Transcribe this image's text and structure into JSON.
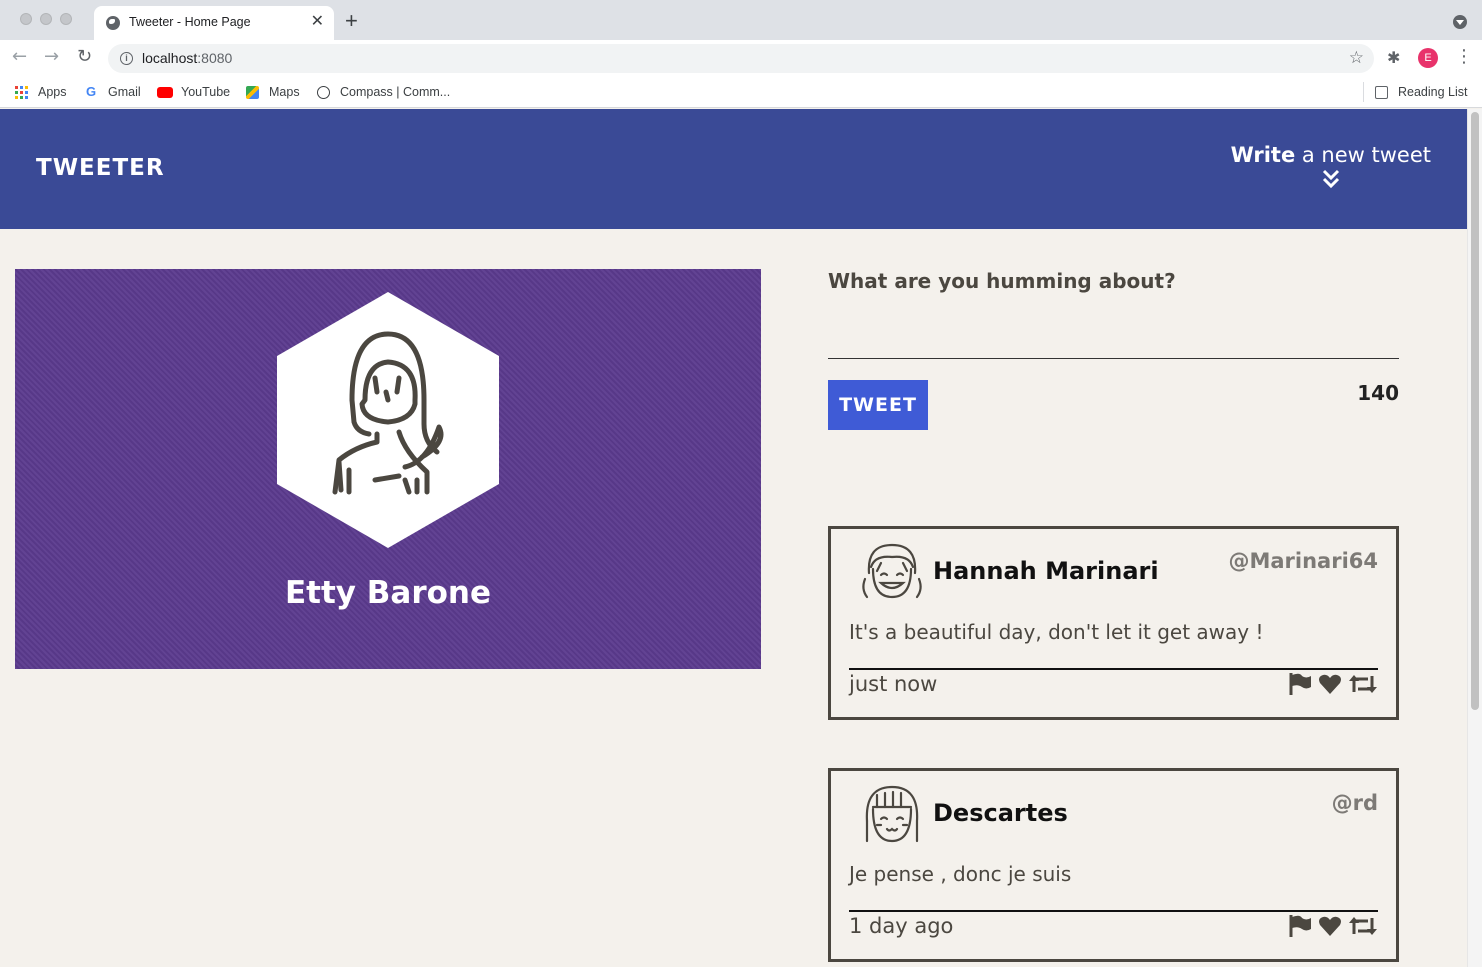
{
  "browser": {
    "tab_title": "Tweeter - Home Page",
    "tab_close": "✕",
    "new_tab": "+",
    "url_host": "localhost",
    "url_port": ":8080",
    "avatar_initial": "E",
    "bookmarks": [
      {
        "label": "Apps",
        "icon": "apps-grid-icon"
      },
      {
        "label": "Gmail",
        "icon": "google-icon"
      },
      {
        "label": "YouTube",
        "icon": "youtube-icon"
      },
      {
        "label": "Maps",
        "icon": "maps-icon"
      },
      {
        "label": "Compass | Comm...",
        "icon": "compass-icon"
      }
    ],
    "reading_list": "Reading List"
  },
  "header": {
    "logo": "TWEETER",
    "compose_bold": "Write",
    "compose_rest": " a new tweet"
  },
  "profile": {
    "name": "Etty Barone",
    "background_color": "#5c3b8f"
  },
  "composer": {
    "prompt": "What are you humming about?",
    "value": "",
    "button_label": "TWEET",
    "counter": "140"
  },
  "tweets": [
    {
      "name": "Hannah Marinari",
      "handle": "@Marinari64",
      "text": "It's a beautiful day, don't let it get away !",
      "time": "just now"
    },
    {
      "name": "Descartes",
      "handle": "@rd",
      "text": "Je pense , donc je suis",
      "time": "1 day ago"
    }
  ],
  "colors": {
    "header": "#3a4a96",
    "tweet_button": "#3f5bd6",
    "page_bg": "#f4f1ec",
    "ink": "#4b4740"
  }
}
